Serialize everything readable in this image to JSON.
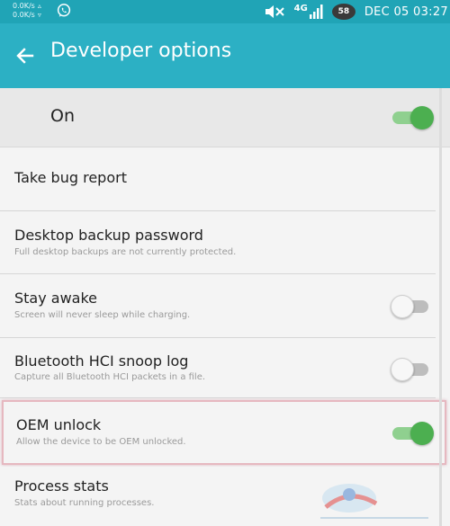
{
  "status_bar": {
    "net_up": "0.0K/s",
    "net_down": "0.0K/s",
    "network_type": "4G",
    "battery": "58",
    "clock": "DEC 05 03:27",
    "icons": [
      "whatsapp-icon",
      "mute-icon",
      "signal-icon",
      "battery-icon"
    ]
  },
  "app_bar": {
    "title": "Developer options",
    "back_icon": "arrow-left-icon",
    "color": "#2cb0c4"
  },
  "master_toggle": {
    "label": "On",
    "checked": true
  },
  "items": [
    {
      "title": "Take bug report",
      "subtitle": ""
    },
    {
      "title": "Desktop backup password",
      "subtitle": "Full desktop backups are not currently protected."
    },
    {
      "title": "Stay awake",
      "subtitle": "Screen will never sleep while charging.",
      "toggle": false
    },
    {
      "title": "Bluetooth HCI snoop log",
      "subtitle": "Capture all Bluetooth HCI packets in a file.",
      "toggle": false
    },
    {
      "title": "OEM unlock",
      "subtitle": "Allow the device to be OEM unlocked.",
      "toggle": true,
      "highlighted": true
    },
    {
      "title": "Process stats",
      "subtitle": "Stats about running processes."
    }
  ],
  "colors": {
    "status_bar": "#20a4b6",
    "switch_on": "#4caf50",
    "switch_off": "#f7f7f7",
    "highlight_border": "#e6b8c0"
  }
}
